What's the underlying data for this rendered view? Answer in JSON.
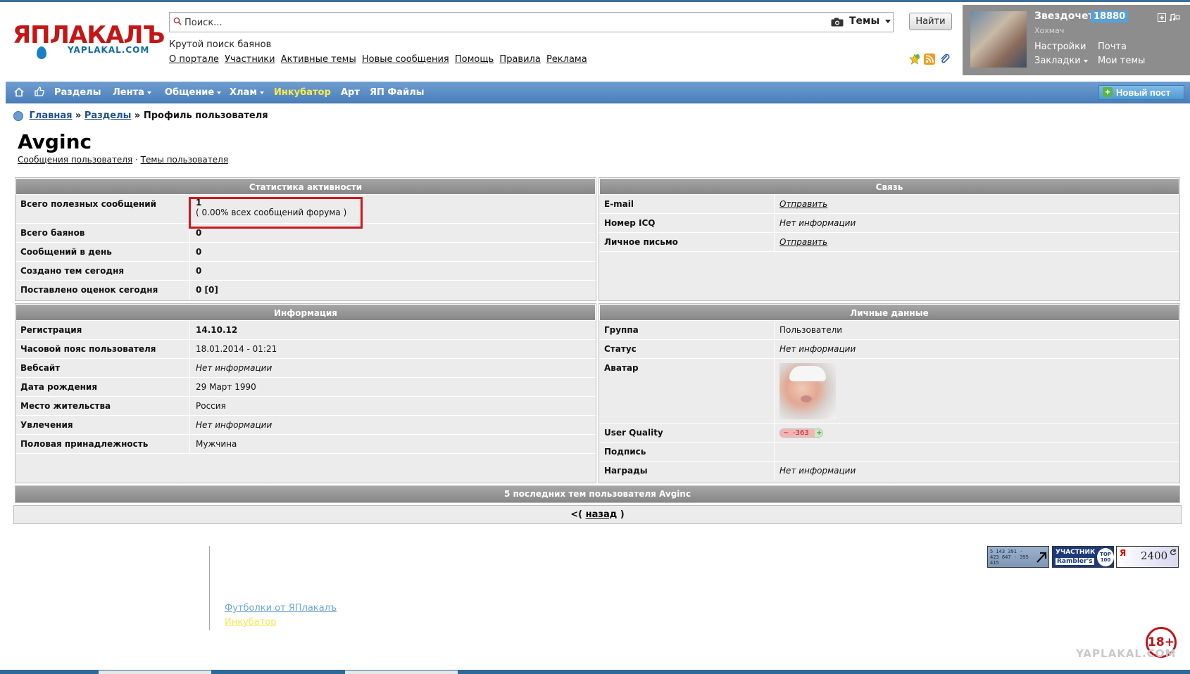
{
  "logo": {
    "main_text": "ЯПЛАКАЛЪ",
    "sub_text": "YAPLAKAL.COM"
  },
  "search": {
    "placeholder": "Поиск...",
    "scope": "Темы",
    "button": "Найти",
    "tagline": "Крутой поиск баянов"
  },
  "top_links": [
    "О портале",
    "Участники",
    "Активные темы",
    "Новые сообщения",
    "Помощь",
    "Правила",
    "Реклама"
  ],
  "user": {
    "name": "Звездочет",
    "score": "18880",
    "subtitle": "Хохмач",
    "settings": "Настройки",
    "mail": "Почта",
    "bookmarks": "Закладки",
    "my_topics": "Мои темы"
  },
  "nav": {
    "items": [
      "Разделы",
      "Лента",
      "Общение",
      "Хлам",
      "Инкубатор",
      "Арт",
      "ЯП Файлы"
    ],
    "new_post": "Новый пост"
  },
  "breadcrumb": {
    "home": "Главная",
    "sections": "Разделы",
    "sep": "»",
    "current": "Профиль пользователя"
  },
  "profile": {
    "name": "Avginc",
    "messages_link": "Сообщения пользователя",
    "dot": "·",
    "topics_link": "Темы пользователя"
  },
  "stats": {
    "title": "Статистика активности",
    "rows": [
      {
        "label": "Всего полезных сообщений",
        "value": "1",
        "extra": "( 0.00% всех сообщений форума )"
      },
      {
        "label": "Всего баянов",
        "value": "0"
      },
      {
        "label": "Сообщений в день",
        "value": "0"
      },
      {
        "label": "Создано тем сегодня",
        "value": "0"
      },
      {
        "label": "Поставлено оценок сегодня",
        "value": "0 [0]"
      }
    ]
  },
  "contact": {
    "title": "Связь",
    "rows": [
      {
        "label": "E-mail",
        "value": "Отправить"
      },
      {
        "label": "Номер ICQ",
        "value": "Нет информации"
      },
      {
        "label": "Личное письмо",
        "value": "Отправить"
      }
    ]
  },
  "info": {
    "title": "Информация",
    "rows": [
      {
        "label": "Регистрация",
        "value": "14.10.12"
      },
      {
        "label": "Часовой пояс пользователя",
        "value": "18.01.2014 - 01:21"
      },
      {
        "label": "Вебсайт",
        "value": "Нет информации"
      },
      {
        "label": "Дата рождения",
        "value": "29 Март 1990"
      },
      {
        "label": "Место жительства",
        "value": "Россия"
      },
      {
        "label": "Увлечения",
        "value": "Нет информации"
      },
      {
        "label": "Половая принадлежность",
        "value": "Мужчина"
      }
    ]
  },
  "personal": {
    "title": "Личные данные",
    "rows": [
      {
        "label": "Группа",
        "value": "Пользователи"
      },
      {
        "label": "Статус",
        "value": "Нет информации"
      },
      {
        "label": "Аватар",
        "value": ""
      },
      {
        "label": "User Quality",
        "value": "-363"
      },
      {
        "label": "Подпись",
        "value": ""
      },
      {
        "label": "Награды",
        "value": "Нет информации"
      }
    ]
  },
  "recent_topics": "5 последних тем пользователя Avginc",
  "back": {
    "prefix": "<(",
    "link": "назад",
    "suffix": ")"
  },
  "footer": {
    "shirts": "Футболки от ЯПлакалъ",
    "incubator": "Инкубатор",
    "counter_li": "5 143 391 · 423 847 · 395 415",
    "counter_rambler_top": "УЧАСТНИК",
    "counter_rambler_bottom": "Rambler's",
    "counter_rambler_badge": "TOP 100",
    "counter_ya_letter": "Я",
    "counter_ya_value": "2400",
    "age": "18+",
    "watermark": "YAPLAKAL.COM"
  },
  "colors": {
    "nav_blue": "#4a7fbb",
    "highlight_red": "#d0161e",
    "incubator_yellow": "#ffec4a",
    "panel_gray": "#ececec"
  }
}
